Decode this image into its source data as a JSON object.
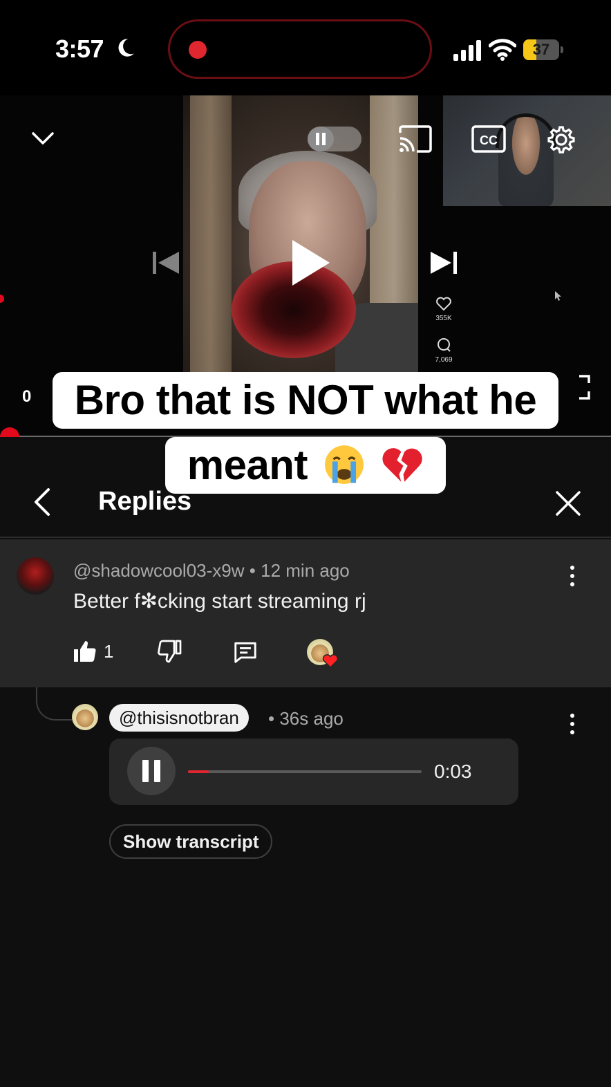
{
  "status_bar": {
    "time": "3:57",
    "battery": "37",
    "battery_level": 0.37
  },
  "player": {
    "time_fragment": "0",
    "overlay_stats": {
      "likes": "355K",
      "comments": "7,069"
    },
    "progress": 0.0
  },
  "caption": {
    "line1": "Bro that is NOT what he",
    "line2": "meant"
  },
  "panel": {
    "title": "Replies"
  },
  "parent_comment": {
    "handle": "@shadowcool03-x9w",
    "age": "12 min ago",
    "separator": "•",
    "text": "Better f✻cking start streaming rj",
    "like_count": "1"
  },
  "reply": {
    "handle": "@thisisnotbran",
    "age": "36s ago",
    "separator": "•",
    "voice_duration": "0:03",
    "voice_progress": 0.09,
    "transcript_label": "Show transcript"
  },
  "colors": {
    "accent_red": "#e00a1c",
    "battery_yellow": "#f5c617",
    "panel_bg": "#0f0f0f",
    "card_bg": "#272727"
  },
  "icons": [
    "moon-icon",
    "signal-icon",
    "wifi-icon",
    "chevron-down-icon",
    "pause-icon",
    "cast-icon",
    "cc-icon",
    "gear-icon",
    "previous-icon",
    "play-icon",
    "next-icon",
    "back-arrow-icon",
    "close-icon",
    "more-vert-icon",
    "thumbs-up-icon",
    "thumbs-down-icon",
    "reply-icon",
    "heart-icon"
  ]
}
